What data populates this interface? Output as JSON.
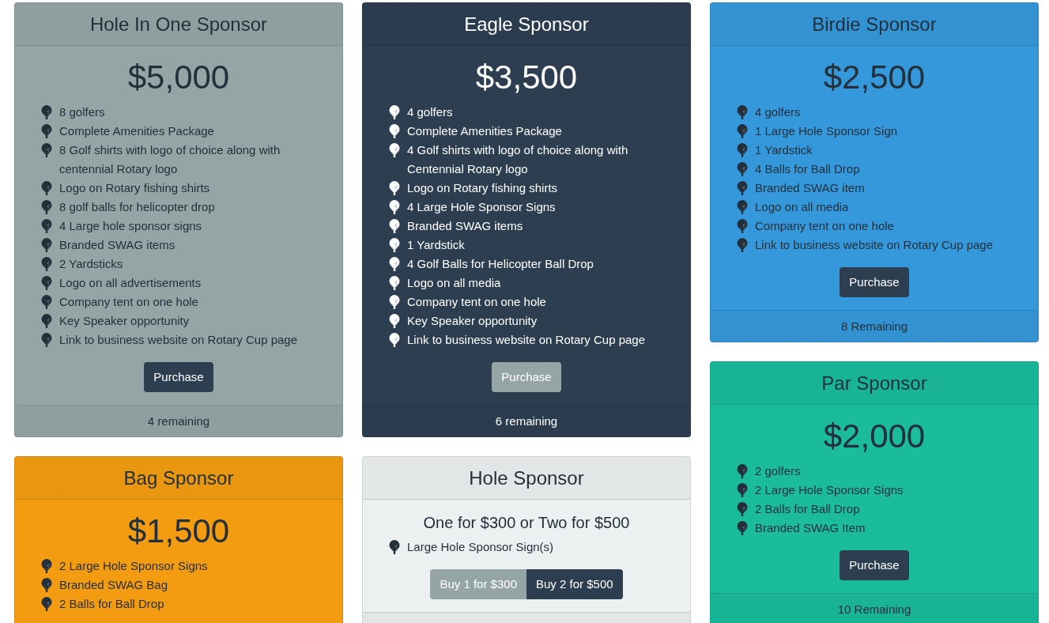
{
  "columns": [
    {
      "cards": [
        {
          "title": "Hole In One Sponsor",
          "color": "#95a5a6",
          "price": "$5,000",
          "features": [
            "8 golfers",
            "Complete Amenities Package",
            "8 Golf shirts with logo of choice along with centennial Rotary logo",
            "Logo on Rotary fishing shirts",
            "8 golf balls for helicopter drop",
            "4 Large hole sponsor signs",
            "Branded SWAG items",
            "2 Yardsticks",
            "Logo on all advertisements",
            "Company tent on one hole",
            "Key Speaker opportunity",
            "Link to business website on Rotary Cup page"
          ],
          "buttons": [
            {
              "label": "Purchase",
              "kind": "primary"
            }
          ],
          "remaining": "4 remaining"
        },
        {
          "title": "Bag Sponsor",
          "color": "#f39c12",
          "price": "$1,500",
          "features": [
            "2 Large Hole Sponsor Signs",
            "Branded SWAG Bag",
            "2 Balls for Ball Drop"
          ]
        }
      ]
    },
    {
      "cards": [
        {
          "title": "Eagle Sponsor",
          "color": "#2c3e50",
          "price": "$3,500",
          "features": [
            "4 golfers",
            "Complete Amenities Package",
            "4 Golf shirts with logo of choice along with Centennial Rotary logo",
            "Logo on Rotary fishing shirts",
            "4 Large Hole Sponsor Signs",
            "Branded SWAG items",
            "1 Yardstick",
            "4 Golf Balls for Helicopter Ball Drop",
            "Logo on all media",
            "Company tent on one hole",
            "Key Speaker opportunity",
            "Link to business website on Rotary Cup page"
          ],
          "buttons": [
            {
              "label": "Purchase",
              "kind": "secondary"
            }
          ],
          "remaining": "6 remaining"
        },
        {
          "title": "Hole Sponsor",
          "color": "#ecf0f1",
          "subtitle": "One for $300 or Two for $500",
          "features": [
            "Large Hole Sponsor Sign(s)"
          ],
          "buttons": [
            {
              "label": "Buy 1 for $300",
              "kind": "secondary"
            },
            {
              "label": "Buy 2 for $500",
              "kind": "primary"
            }
          ]
        }
      ]
    },
    {
      "cards": [
        {
          "title": "Birdie Sponsor",
          "color": "#3498db",
          "price": "$2,500",
          "features": [
            "4 golfers",
            "1 Large Hole Sponsor Sign",
            "1 Yardstick",
            "4 Balls for Ball Drop",
            "Branded SWAG item",
            "Logo on all media",
            "Company tent on one hole",
            "Link to business website on Rotary Cup page"
          ],
          "buttons": [
            {
              "label": "Purchase",
              "kind": "primary"
            }
          ],
          "remaining": "8 Remaining"
        },
        {
          "title": "Par Sponsor",
          "color": "#1abc9c",
          "price": "$2,000",
          "features": [
            "2 golfers",
            "2 Large Hole Sponsor Signs",
            "2 Balls for Ball Drop",
            "Branded SWAG Item"
          ],
          "buttons": [
            {
              "label": "Purchase",
              "kind": "primary"
            }
          ],
          "remaining": "10 Remaining"
        }
      ]
    }
  ]
}
